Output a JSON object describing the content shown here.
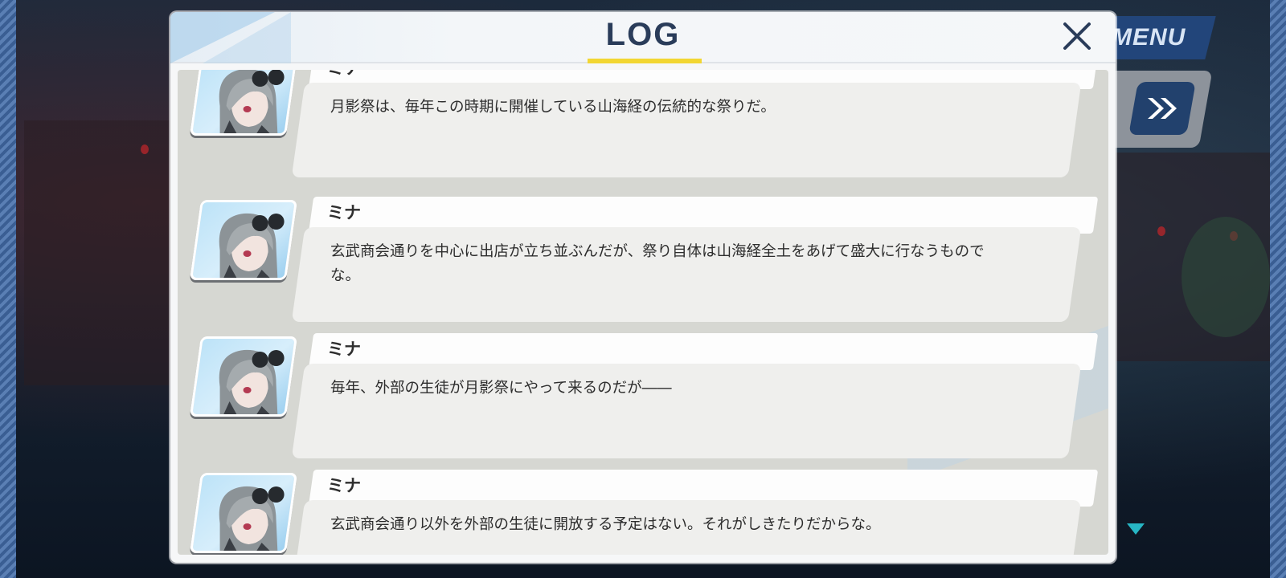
{
  "menu": {
    "label": "MENU",
    "icon": "menu-label"
  },
  "controls": {
    "skip_icon": "fast-forward-icon",
    "auto_icon": "auto-play-icon"
  },
  "log": {
    "title": "LOG",
    "close_icon": "close-icon",
    "entries": [
      {
        "speaker": "ミナ",
        "text": "月影祭は、毎年この時期に開催している山海経の伝統的な祭りだ。"
      },
      {
        "speaker": "ミナ",
        "text": "玄武商会通りを中心に出店が立ち並ぶんだが、祭り自体は山海経全土をあげて盛大に行なうものでな。"
      },
      {
        "speaker": "ミナ",
        "text": "毎年、外部の生徒が月影祭にやって来るのだが――"
      },
      {
        "speaker": "ミナ",
        "text": "玄武商会通り以外を外部の生徒に開放する予定はない。それがしきたりだからな。"
      }
    ]
  },
  "colors": {
    "accent_underline": "#f2d633",
    "title_text": "#2a3c5a",
    "menu_bg": "#22457a",
    "scroll_indicator": "#27b6c4"
  }
}
